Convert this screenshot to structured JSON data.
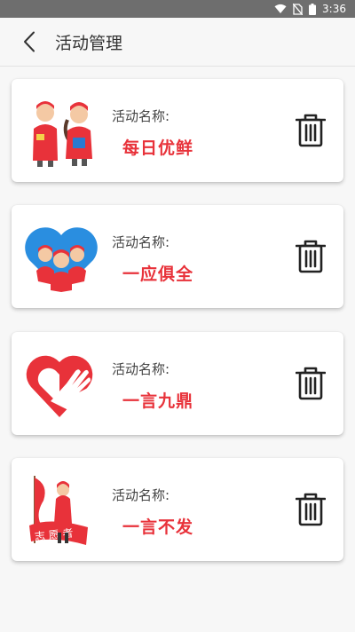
{
  "status_bar": {
    "time": "3:36"
  },
  "header": {
    "title": "活动管理"
  },
  "activities": [
    {
      "label": "活动名称:",
      "name": "每日优鲜"
    },
    {
      "label": "活动名称:",
      "name": "一应俱全"
    },
    {
      "label": "活动名称:",
      "name": "一言九鼎"
    },
    {
      "label": "活动名称:",
      "name": "一言不发"
    }
  ],
  "colors": {
    "accent": "#e8323a",
    "volunteer_blue": "#2a8ee0"
  },
  "icons": {
    "back": "chevron-left-icon",
    "delete": "trash-icon",
    "thumbs": [
      "volunteers-illustration",
      "volunteers-heart-illustration",
      "heart-hand-logo",
      "volunteer-flag-illustration"
    ]
  }
}
